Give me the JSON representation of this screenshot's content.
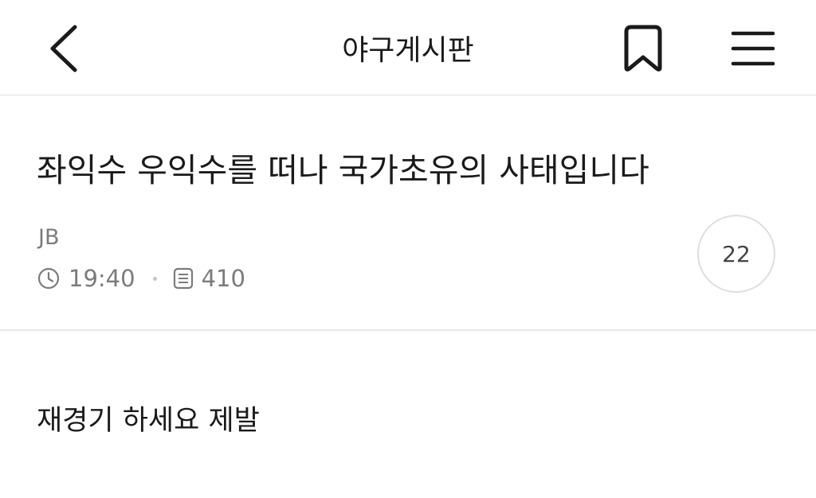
{
  "header": {
    "title": "야구게시판",
    "back_icon": "chevron-left-icon",
    "bookmark_icon": "bookmark-icon",
    "menu_icon": "hamburger-menu-icon"
  },
  "post": {
    "title": "좌익수 우익수를 떠나 국가초유의 사태입니다",
    "author": "JB",
    "time": "19:40",
    "views": "410",
    "comment_count": "22",
    "body": "재경기 하세요 제발"
  },
  "colors": {
    "text": "#1a1a1a",
    "meta": "#7b7b7b",
    "divider": "#e2e2e2"
  }
}
